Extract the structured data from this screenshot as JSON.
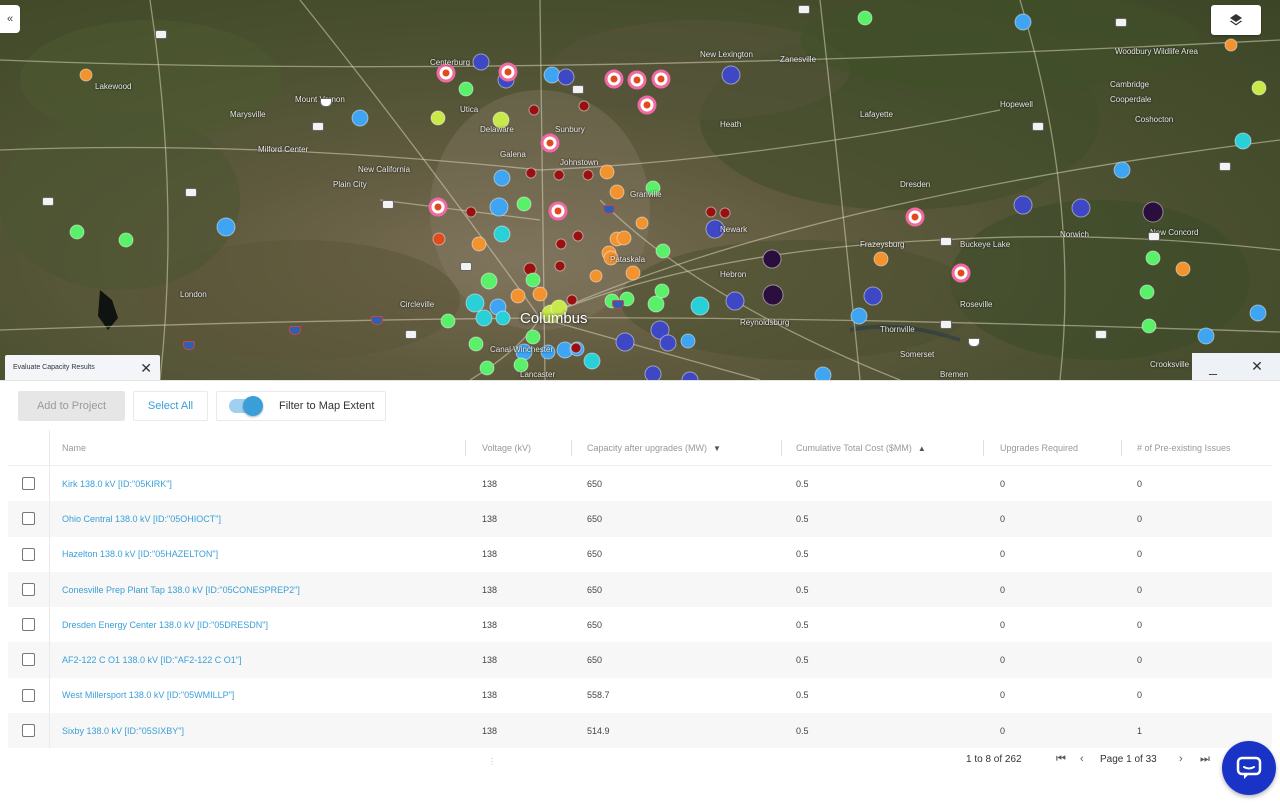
{
  "map": {
    "city_label": "Columbus",
    "place_labels": [
      "Lakewood",
      "Mount Vernon",
      "Milford Center",
      "New California",
      "Plain City",
      "Delaware",
      "Sunbury",
      "Galena",
      "Johnstown",
      "Newark",
      "Granville",
      "Pataskala",
      "Reynoldsburg",
      "Canal Winchester",
      "Lancaster",
      "Circleville",
      "Zanesville",
      "Dresden",
      "Coshocton",
      "Cambridge",
      "Buckeye Lake",
      "Thornville",
      "Somerset",
      "Bremen",
      "London",
      "Marysville",
      "Hebron",
      "Frazeysburg",
      "Woodbury Wildlife Area",
      "Cooperdale",
      "New Concord",
      "Norwich",
      "Lafayette",
      "Hopewell",
      "Roseville",
      "Crooksville",
      "New Lexington",
      "Heath",
      "Utica",
      "Centerburg"
    ],
    "colors": {
      "purple_dark": "#2a0f3e",
      "indigo": "#3e48c4",
      "blue": "#3fa4f2",
      "cyan": "#2ad0d8",
      "green": "#5bf06a",
      "lime": "#c9e84a",
      "orange": "#f39330",
      "red_orange": "#e04b1a",
      "dark_red": "#9a1010",
      "pink_ring": "#f06aa0"
    }
  },
  "map_controls": {
    "collapse_icon": "«",
    "layers_icon_name": "layers-icon",
    "panel_tab_title": "Evaluate Capacity Results",
    "panel_close": "✕",
    "minimize": "_",
    "close": "✕"
  },
  "toolbar": {
    "add_to_project": "Add to Project",
    "select_all": "Select All",
    "filter_label": "Filter to Map Extent",
    "filter_on": true
  },
  "table": {
    "columns": [
      "Name",
      "Voltage (kV)",
      "Capacity after upgrades (MW)",
      "Cumulative Total Cost ($MM)",
      "Upgrades Required",
      "# of Pre-existing Issues"
    ],
    "rows": [
      {
        "name": "Kirk 138.0 kV [ID:\"05KIRK\"]",
        "voltage": "138",
        "capacity": "650",
        "cost": "0.5",
        "upgrades": "0",
        "issues": "0"
      },
      {
        "name": "Ohio Central 138.0 kV [ID:\"05OHIOCT\"]",
        "voltage": "138",
        "capacity": "650",
        "cost": "0.5",
        "upgrades": "0",
        "issues": "0"
      },
      {
        "name": "Hazelton 138.0 kV [ID:\"05HAZELTON\"]",
        "voltage": "138",
        "capacity": "650",
        "cost": "0.5",
        "upgrades": "0",
        "issues": "0"
      },
      {
        "name": "Conesville Prep Plant Tap 138.0 kV [ID:\"05CONESPREP2\"]",
        "voltage": "138",
        "capacity": "650",
        "cost": "0.5",
        "upgrades": "0",
        "issues": "0"
      },
      {
        "name": "Dresden Energy Center 138.0 kV [ID:\"05DRESDN\"]",
        "voltage": "138",
        "capacity": "650",
        "cost": "0.5",
        "upgrades": "0",
        "issues": "0"
      },
      {
        "name": "AF2-122 C O1 138.0 kV [ID:\"AF2-122 C O1\"]",
        "voltage": "138",
        "capacity": "650",
        "cost": "0.5",
        "upgrades": "0",
        "issues": "0"
      },
      {
        "name": "West Millersport 138.0 kV [ID:\"05WMILLP\"]",
        "voltage": "138",
        "capacity": "558.7",
        "cost": "0.5",
        "upgrades": "0",
        "issues": "0"
      },
      {
        "name": "Sixby 138.0 kV [ID:\"05SIXBY\"]",
        "voltage": "138",
        "capacity": "514.9",
        "cost": "0.5",
        "upgrades": "0",
        "issues": "1"
      }
    ]
  },
  "pager": {
    "info": "1 to 8 of 262",
    "first": "⏮",
    "prev": "‹",
    "page_text": "Page 1 of 33",
    "next": "›",
    "last": "⏭"
  },
  "chat": {
    "icon_name": "chat-icon"
  }
}
